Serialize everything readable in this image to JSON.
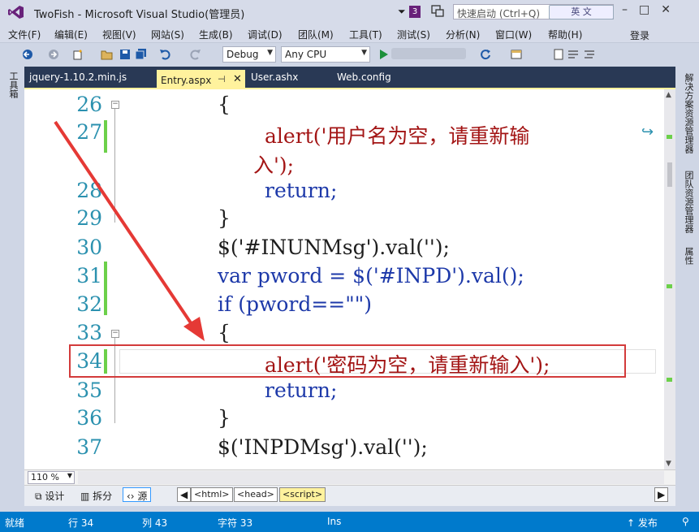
{
  "window": {
    "title": "TwoFish - Microsoft Visual Studio(管理员)",
    "notification_count": "3",
    "quick_launch_placeholder": "快速启动 (Ctrl+Q)",
    "ime_label": "英 文",
    "login": "登录"
  },
  "menu": [
    "文件(F)",
    "编辑(E)",
    "视图(V)",
    "网站(S)",
    "生成(B)",
    "调试(D)",
    "团队(M)",
    "工具(T)",
    "测试(S)",
    "分析(N)",
    "窗口(W)",
    "帮助(H)"
  ],
  "toolbar": {
    "config": "Debug",
    "platform": "Any CPU"
  },
  "side_panels": {
    "left": "工具箱",
    "right": [
      "解决方案资源管理器",
      "团队资源管理器",
      "属性"
    ]
  },
  "tabs": [
    {
      "label": "jquery-1.10.2.min.js",
      "active": false
    },
    {
      "label": "Entry.aspx",
      "active": true
    },
    {
      "label": "User.ashx",
      "active": false
    },
    {
      "label": "Web.config",
      "active": false
    }
  ],
  "editor": {
    "lines": [
      {
        "n": "26",
        "text": "{"
      },
      {
        "n": "27",
        "text": "alert('用户名为空，请重新输"
      },
      {
        "n": "",
        "text": "入');"
      },
      {
        "n": "28",
        "text": "return;"
      },
      {
        "n": "29",
        "text": "}"
      },
      {
        "n": "30",
        "text": "$('#INUNMsg').val('');"
      },
      {
        "n": "31",
        "text": "var pword = $('#INPD').val();"
      },
      {
        "n": "32",
        "text": "if (pword==\"\")"
      },
      {
        "n": "33",
        "text": "{"
      },
      {
        "n": "34",
        "text": "alert('密码为空，请重新输入');"
      },
      {
        "n": "35",
        "text": "return;"
      },
      {
        "n": "36",
        "text": "}"
      },
      {
        "n": "37",
        "text": "$('INPDMsg').val('');"
      }
    ]
  },
  "zoom": "110 %",
  "viewbar": {
    "design": "设计",
    "split": "拆分",
    "source": "源",
    "tags": [
      "<html>",
      "<head>",
      "<script>"
    ]
  },
  "status": {
    "ready": "就绪",
    "line": "行 34",
    "col": "列 43",
    "char": "字符 33",
    "mode": "Ins",
    "publish": "发布"
  }
}
